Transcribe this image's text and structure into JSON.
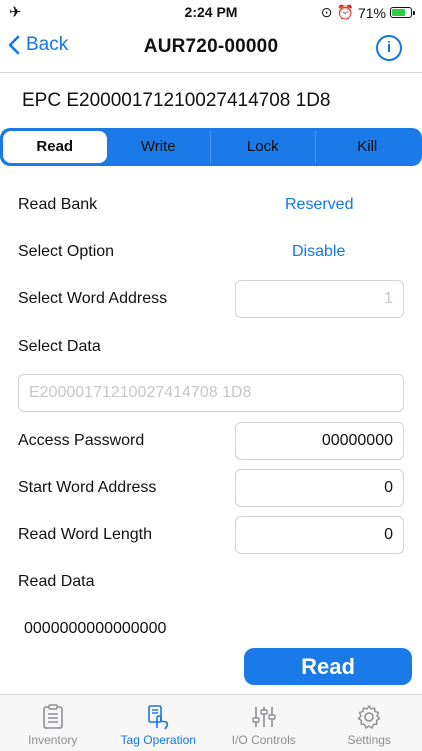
{
  "status": {
    "time": "2:24 PM",
    "battery": "71%",
    "battery_level": 0.71
  },
  "nav": {
    "back_label": "Back",
    "title": "AUR720-00000",
    "info_label": "i"
  },
  "epc": "EPC E20000171210027414708 1D8",
  "tabs": [
    {
      "label": "Read",
      "active": true
    },
    {
      "label": "Write",
      "active": false
    },
    {
      "label": "Lock",
      "active": false
    },
    {
      "label": "Kill",
      "active": false
    }
  ],
  "form": {
    "read_bank_label": "Read Bank",
    "read_bank_value": "Reserved",
    "select_option_label": "Select Option",
    "select_option_value": "Disable",
    "select_word_address_label": "Select Word Address",
    "select_word_address_placeholder": "1",
    "select_data_label": "Select Data",
    "select_data_placeholder": "E20000171210027414708 1D8",
    "access_password_label": "Access Password",
    "access_password_value": "00000000",
    "start_word_address_label": "Start Word Address",
    "start_word_address_value": "0",
    "read_word_length_label": "Read Word Length",
    "read_word_length_value": "0",
    "read_data_label": "Read Data",
    "read_data_value": "0000000000000000"
  },
  "read_button_label": "Read",
  "tabbar": [
    {
      "label": "Inventory",
      "icon": "clipboard-list-icon",
      "active": false
    },
    {
      "label": "Tag Operation",
      "icon": "tag-hand-icon",
      "active": true
    },
    {
      "label": "I/O Controls",
      "icon": "sliders-icon",
      "active": false
    },
    {
      "label": "Settings",
      "icon": "gear-icon",
      "active": false
    }
  ],
  "colors": {
    "accent": "#1a7ae8",
    "link": "#1476e6",
    "tab_inactive": "#8e8e93"
  }
}
